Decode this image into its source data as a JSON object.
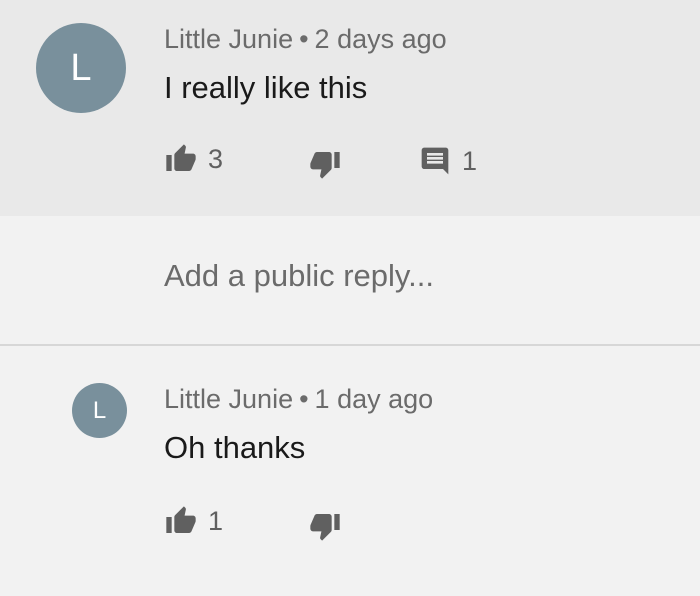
{
  "comment": {
    "avatar_letter": "L",
    "author": "Little Junie",
    "separator": "•",
    "time": "2 days ago",
    "text": "I really like this",
    "likes": "3",
    "replies": "1"
  },
  "reply_field": {
    "placeholder": "Add a public reply..."
  },
  "reply": {
    "avatar_letter": "L",
    "author": "Little Junie",
    "separator": "•",
    "time": "1 day ago",
    "text": "Oh thanks",
    "likes": "1"
  },
  "colors": {
    "avatar": "#79909c",
    "highlighted_background": "#e9e9e9",
    "background": "#f2f2f2",
    "icon": "#606060"
  },
  "icons": {
    "like": "thumbs-up-icon",
    "dislike": "thumbs-down-icon",
    "reply": "comment-icon"
  }
}
